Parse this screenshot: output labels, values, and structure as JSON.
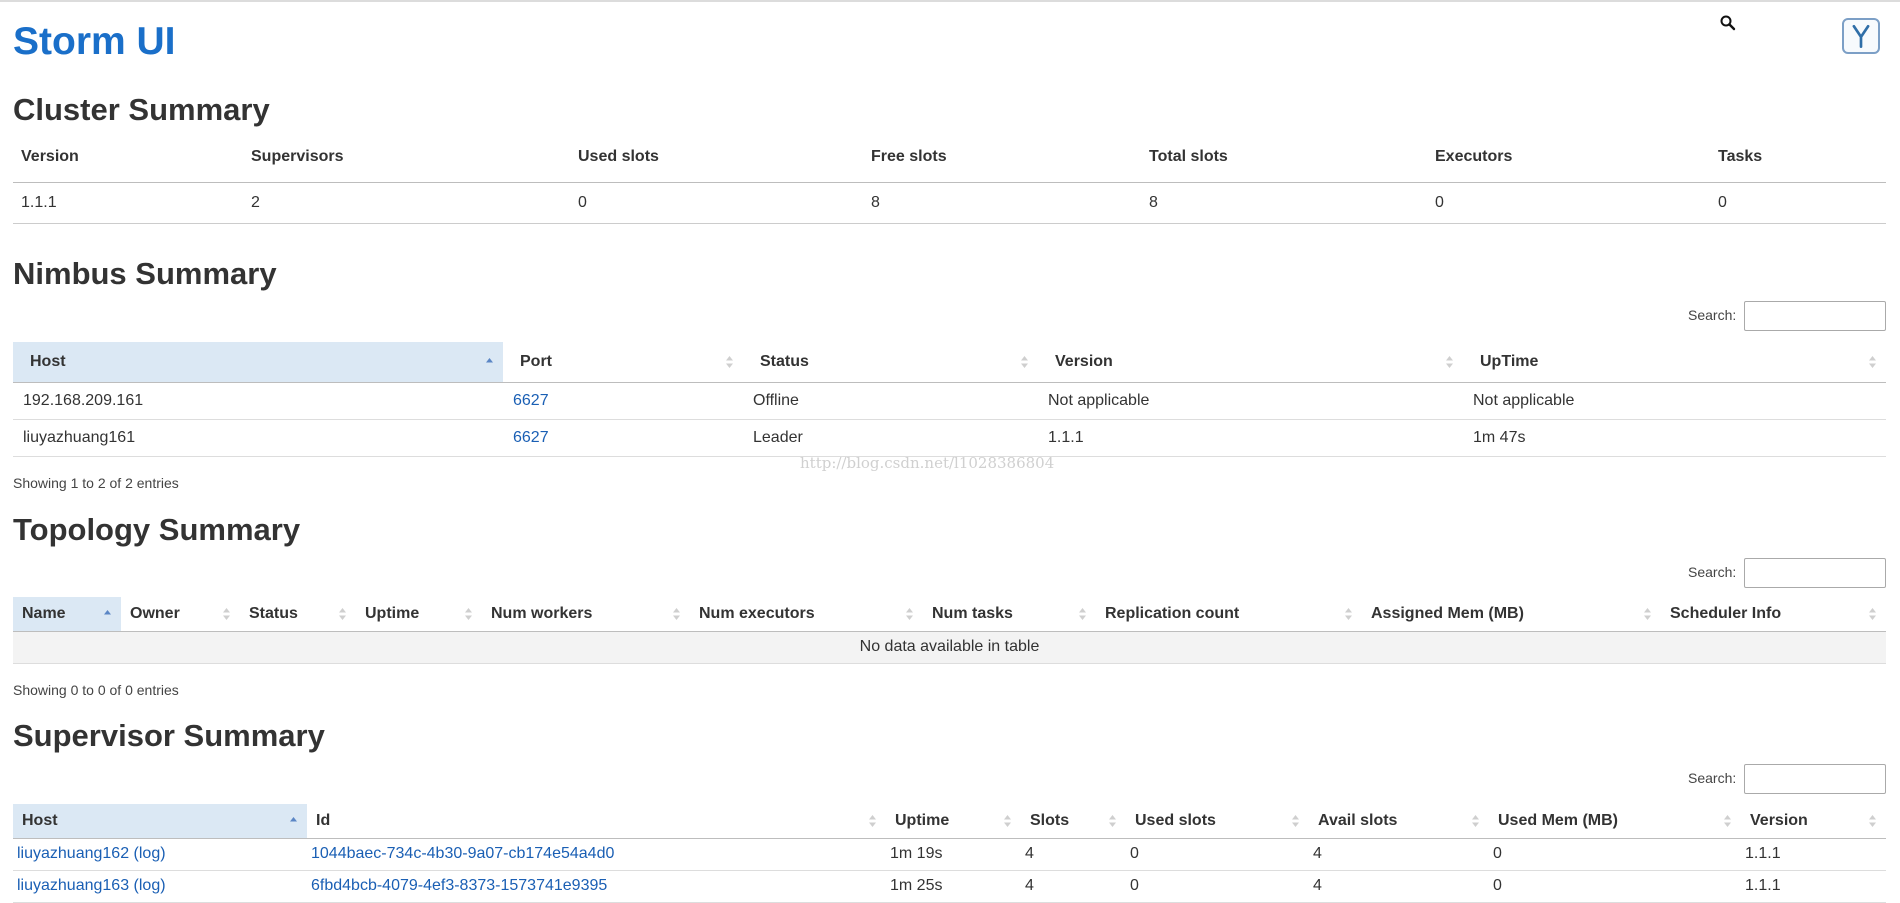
{
  "app": {
    "title": "Storm UI"
  },
  "icons": {
    "search": "search-icon",
    "logo": "y-logo-icon"
  },
  "colors": {
    "link": "#1a5fb4",
    "title": "#1a6fc9",
    "sorted_header": "#dbe8f4"
  },
  "cluster": {
    "title": "Cluster Summary",
    "columns": [
      "Version",
      "Supervisors",
      "Used slots",
      "Free slots",
      "Total slots",
      "Executors",
      "Tasks"
    ],
    "row": [
      "1.1.1",
      "2",
      "0",
      "8",
      "8",
      "0",
      "0"
    ]
  },
  "nimbus": {
    "title": "Nimbus Summary",
    "search_label": "Search:",
    "search_value": "",
    "columns": [
      "Host",
      "Port",
      "Status",
      "Version",
      "UpTime"
    ],
    "rows": [
      [
        "192.168.209.161",
        "6627",
        "Offline",
        "Not applicable",
        "Not applicable"
      ],
      [
        "liuyazhuang161",
        "6627",
        "Leader",
        "1.1.1",
        "1m 47s"
      ]
    ],
    "info": "Showing 1 to 2 of 2 entries"
  },
  "watermark": "http://blog.csdn.net/l1028386804",
  "topology": {
    "title": "Topology Summary",
    "search_label": "Search:",
    "search_value": "",
    "columns": [
      "Name",
      "Owner",
      "Status",
      "Uptime",
      "Num workers",
      "Num executors",
      "Num tasks",
      "Replication count",
      "Assigned Mem (MB)",
      "Scheduler Info"
    ],
    "empty": "No data available in table",
    "info": "Showing 0 to 0 of 0 entries"
  },
  "supervisor": {
    "title": "Supervisor Summary",
    "search_label": "Search:",
    "search_value": "",
    "columns": [
      "Host",
      "Id",
      "Uptime",
      "Slots",
      "Used slots",
      "Avail slots",
      "Used Mem (MB)",
      "Version"
    ],
    "log_label": "(log)",
    "rows": [
      {
        "host": "liuyazhuang162",
        "id": "1044baec-734c-4b30-9a07-cb174e54a4d0",
        "uptime": "1m 19s",
        "slots": "4",
        "used": "0",
        "avail": "4",
        "mem": "0",
        "version": "1.1.1"
      },
      {
        "host": "liuyazhuang163",
        "id": "6fbd4bcb-4079-4ef3-8373-1573741e9395",
        "uptime": "1m 25s",
        "slots": "4",
        "used": "0",
        "avail": "4",
        "mem": "0",
        "version": "1.1.1"
      }
    ]
  }
}
